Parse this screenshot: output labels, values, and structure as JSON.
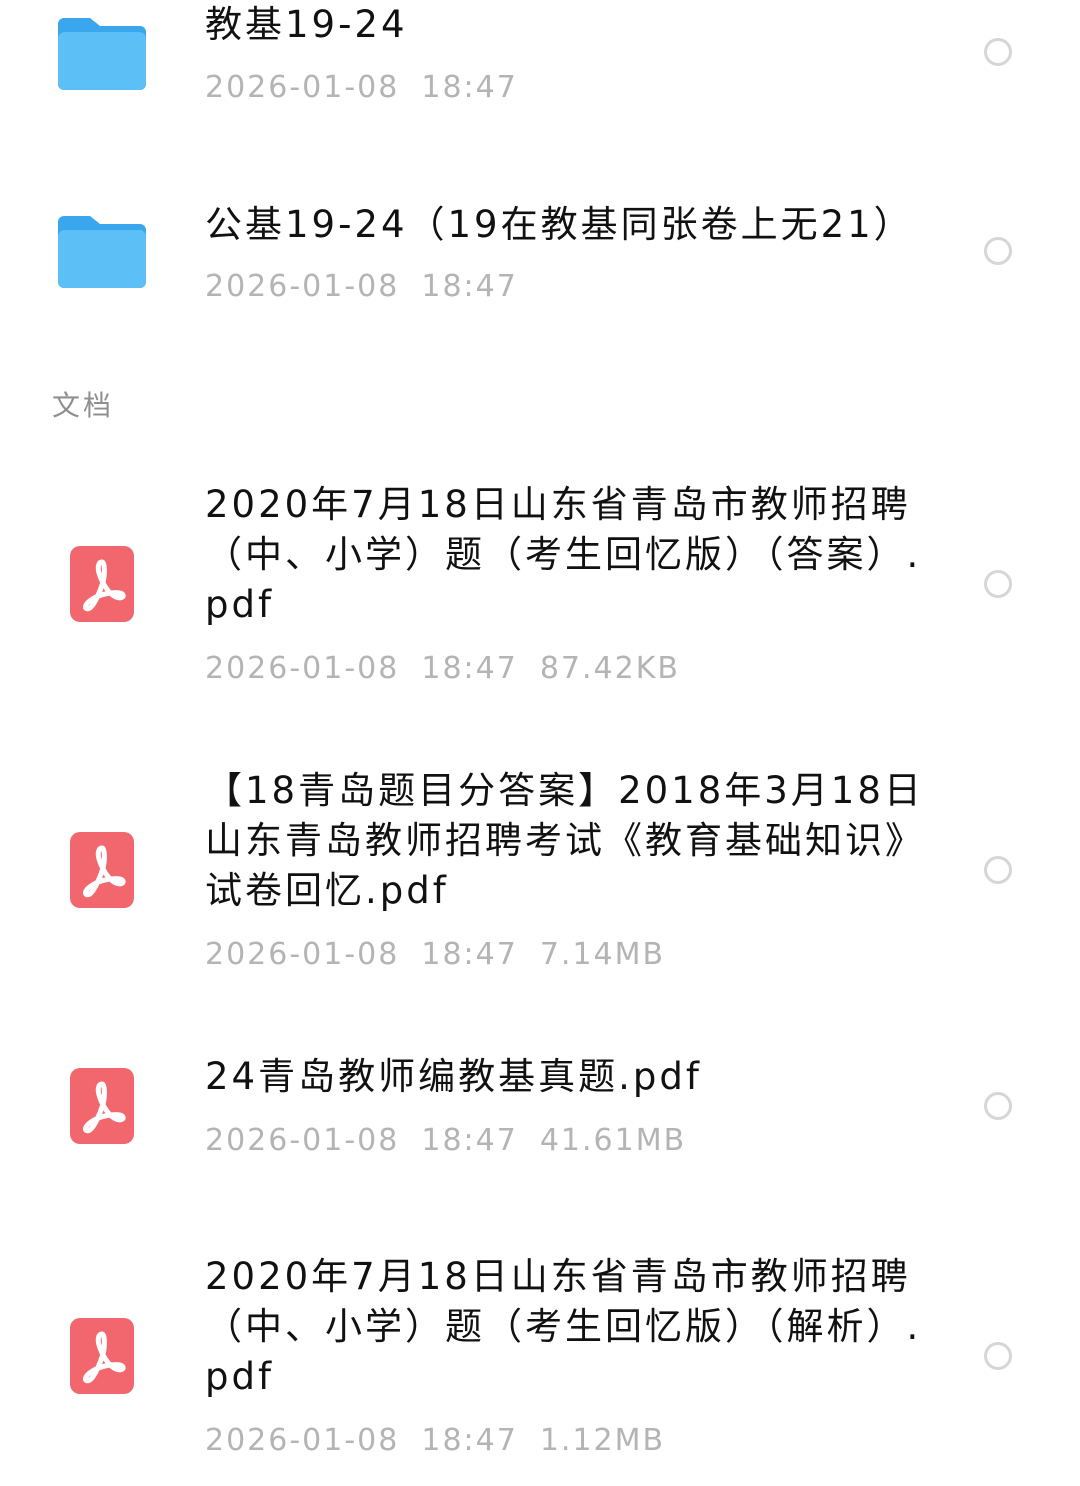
{
  "folders": [
    {
      "icon": "folder-icon",
      "name": "教基19-24",
      "date": "2026-01-08",
      "time": "18:47"
    },
    {
      "icon": "folder-icon",
      "name": "公基19-24（19在教基同张卷上无21）",
      "date": "2026-01-08",
      "time": "18:47"
    }
  ],
  "section": {
    "label": "文档"
  },
  "documents": [
    {
      "icon": "pdf-icon",
      "name": "2020年7月18日山东省青岛市教师招聘（中、小学）题（考生回忆版）（答案）.pdf",
      "date": "2026-01-08",
      "time": "18:47",
      "size": "87.42KB"
    },
    {
      "icon": "pdf-icon",
      "name": "【18青岛题目分答案】2018年3月18日山东青岛教师招聘考试《教育基础知识》试卷回忆.pdf",
      "date": "2026-01-08",
      "time": "18:47",
      "size": "7.14MB"
    },
    {
      "icon": "pdf-icon",
      "name": "24青岛教师编教基真题.pdf",
      "date": "2026-01-08",
      "time": "18:47",
      "size": "41.61MB"
    },
    {
      "icon": "pdf-icon",
      "name": "2020年7月18日山东省青岛市教师招聘（中、小学）题（考生回忆版）（解析）.pdf",
      "date": "2026-01-08",
      "time": "18:47",
      "size": "1.12MB"
    }
  ],
  "colors": {
    "folder": "#4fb6f2",
    "pdf": "#f2676e",
    "meta_text": "#b4b4b4",
    "radio_border": "#d6d6d6"
  }
}
